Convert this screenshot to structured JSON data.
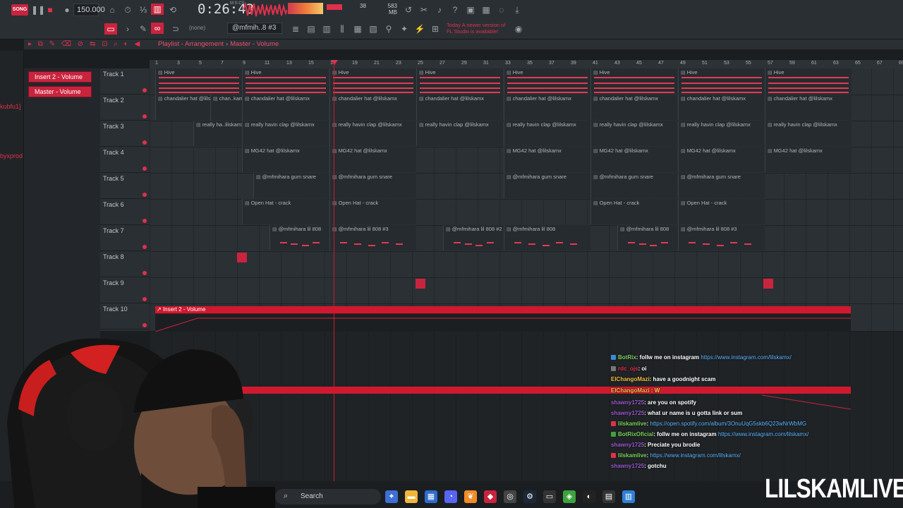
{
  "toolbar": {
    "song_mode_label": "SONG",
    "tempo": "150.000",
    "time": "0:26:43",
    "time_unit": "M:S:CS",
    "memory": "583 MB",
    "poly": "38",
    "cpu_small": "7",
    "snap": "(none)",
    "pattern": "@mfmih..8 #3",
    "news_line1": "Today  A newer version of",
    "news_line2": "FL Studio is available!"
  },
  "browser": {
    "label1": "kubfu1]",
    "label2": "byxprod"
  },
  "playlist": {
    "breadcrumb_main": "Playlist - Arrangement",
    "breadcrumb_sub": "Master - Volume"
  },
  "auto_clips": [
    "Insert 2 - Volume",
    "Master - Volume"
  ],
  "ruler": [
    "1",
    "3",
    "5",
    "7",
    "9",
    "11",
    "13",
    "15",
    "17",
    "19",
    "21",
    "23",
    "25",
    "27",
    "29",
    "31",
    "33",
    "35",
    "37",
    "39",
    "41",
    "43",
    "45",
    "47",
    "49",
    "51",
    "53",
    "55",
    "57",
    "59",
    "61",
    "63",
    "65",
    "67",
    "69"
  ],
  "tracks": [
    "Track 1",
    "Track 2",
    "Track 3",
    "Track 4",
    "Track 5",
    "Track 6",
    "Track 7",
    "Track 8",
    "Track 9",
    "Track 10"
  ],
  "clip_names": {
    "hive": "Hive",
    "hat": "chandalier hat @lilskamx",
    "hat_short1": "chandalier hat @lils",
    "hat_short2": "chan..kamx",
    "clap": "really havin clap @lilskamx",
    "clap_short": "really ha..lilskamx",
    "mg42": "MG42 hat @lilskamx",
    "snare": "@mfmihara gum snare",
    "openhat": "Open Hat - crack",
    "b808": "@mfmihara lil 808",
    "b808_3": "@mfmihara lil 808 #3",
    "b808_2": "@mfmihara lil 808 #2"
  },
  "automation_track": "Insert 2 - Volume",
  "chat": [
    {
      "user": "BotRix",
      "user_color": "#7cd35a",
      "text": ": follw me on instagram ",
      "link": "https://www.instagram.com/lilskamx/"
    },
    {
      "user": "rdc_ojs",
      "user_color": "#e0304a",
      "text": ": oi",
      "link": ""
    },
    {
      "user": "ElChangoMazi",
      "user_color": "#f0c040",
      "text": ": have a goodnight scam",
      "link": ""
    },
    {
      "user": "ElChangoMazi",
      "user_color": "#f0c040",
      "text": " : W",
      "link": ""
    },
    {
      "user": "shawny1725",
      "user_color": "#9b59d0",
      "text": ": are you on spotify",
      "link": ""
    },
    {
      "user": "shawny1725",
      "user_color": "#9b59d0",
      "text": ": what ur name is u gotta link or sum",
      "link": ""
    },
    {
      "user": "lilskamlive",
      "user_color": "#7cd35a",
      "text": ": ",
      "link": "https://open.spotify.com/album/3OnuUqG5skb6Q23wNrWbMG"
    },
    {
      "user": "BotRixOficial",
      "user_color": "#7cd35a",
      "text": ": follw me on instagram ",
      "link": "https://www.instagram.com/lilskamx/"
    },
    {
      "user": "shawny1725",
      "user_color": "#9b59d0",
      "text": ": Preciate you brodie",
      "link": ""
    },
    {
      "user": "lilskamlive",
      "user_color": "#7cd35a",
      "text": ": ",
      "link": "https://www.instagram.com/lilskamx/"
    },
    {
      "user": "shawny1725",
      "user_color": "#9b59d0",
      "text": ": gotchu",
      "link": ""
    }
  ],
  "taskbar": {
    "search_label": "Search"
  },
  "brand": "LILSKAMLIVE"
}
